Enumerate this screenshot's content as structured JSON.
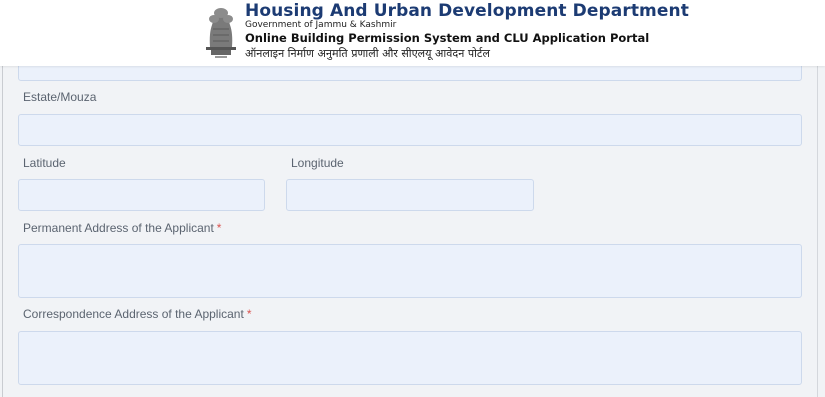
{
  "header": {
    "title": "Housing And Urban Development Department",
    "subtitle": "Government of Jammu & Kashmir",
    "portal": "Online Building Permission System and CLU Application Portal",
    "portal_hindi": "ऑनलाइन निर्माण अनुमति प्रणाली और सीएलयू आवेदन पोर्टल",
    "emblem_icon": "national-emblem-icon"
  },
  "form": {
    "estate_label": "Estate/Mouza",
    "latitude_label": "Latitude",
    "longitude_label": "Longitude",
    "permanent_address_label": "Permanent Address of the Applicant",
    "correspondence_address_label": "Correspondence Address of the Applicant",
    "required_marker": "*"
  },
  "colors": {
    "title": "#1c3b73",
    "field_bg": "#ebf1fb",
    "required": "#d9534f"
  }
}
